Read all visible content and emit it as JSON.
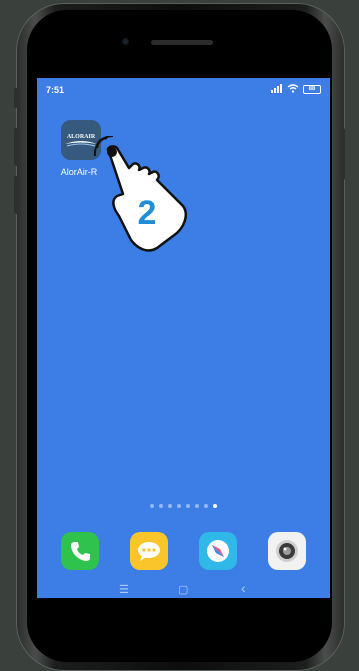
{
  "status_bar": {
    "time": "7:51",
    "signal_icon": "signal-bars-icon",
    "wifi_icon": "wifi-icon",
    "battery_text": "88"
  },
  "home_app": {
    "label": "AlorAir-R",
    "icon_text": "ALORAIR",
    "icon_name": "alorair-app-icon"
  },
  "tutorial_overlay": {
    "step_number": "2",
    "icon_name": "tap-hand-icon"
  },
  "page_indicator": {
    "count": 8,
    "active_index": 7
  },
  "dock": [
    {
      "name": "phone",
      "icon": "phone-icon",
      "color": "#2fc24d"
    },
    {
      "name": "messages",
      "icon": "message-icon",
      "color": "#f9c52b"
    },
    {
      "name": "browser",
      "icon": "browser-compass-icon",
      "color": "#2fb8e8"
    },
    {
      "name": "camera",
      "icon": "camera-icon",
      "color": "#f2f2f2"
    }
  ],
  "nav_bar": {
    "menu_glyph": "☰",
    "home_glyph": "▢",
    "back_glyph": "‹"
  }
}
